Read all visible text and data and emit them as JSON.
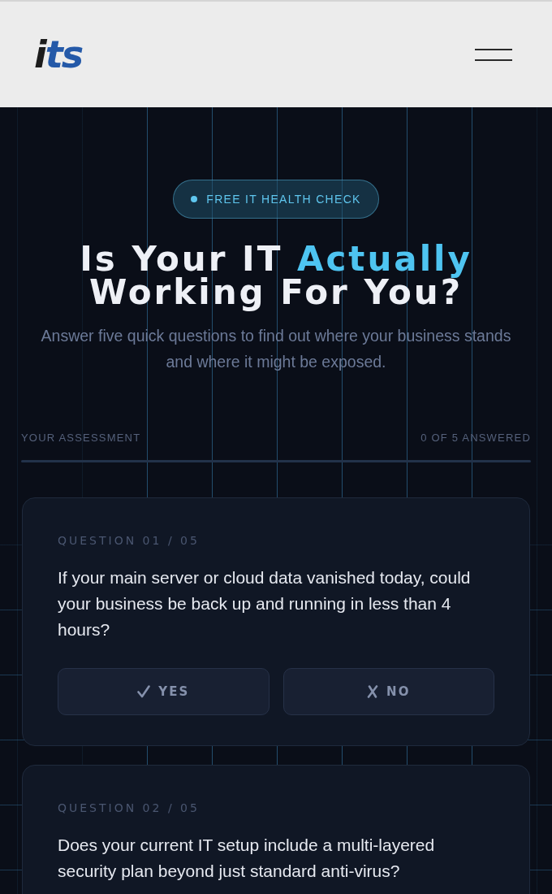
{
  "header": {
    "logo": "its"
  },
  "hero": {
    "badge": "FREE IT HEALTH CHECK",
    "title": [
      {
        "text": "Is Your IT",
        "accent": false
      },
      {
        "text": "Actually",
        "accent": true
      },
      {
        "text": "Working For You?",
        "accent": false
      }
    ],
    "subtitle": "Answer five quick questions to find out where your business stands and where it might be exposed."
  },
  "progress": {
    "label": "YOUR ASSESSMENT",
    "count": "0 OF 5 ANSWERED",
    "level": 0
  },
  "questions": [
    {
      "number": "QUESTION 01 / 05",
      "text": "If your main server or cloud data vanished today, could your business be back up and running in less than 4 hours?",
      "options": [
        {
          "kind": "yes",
          "label": "YES",
          "selected": false
        },
        {
          "kind": "no",
          "label": "NO",
          "selected": false
        }
      ]
    },
    {
      "number": "QUESTION 02 / 05",
      "text": "Does your current IT setup include a multi-layered security plan beyond just standard anti-virus?"
    }
  ]
}
